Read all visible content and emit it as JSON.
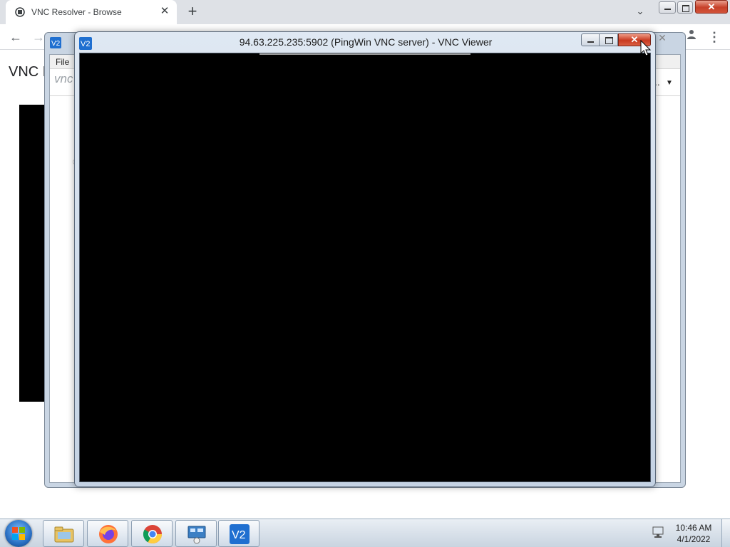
{
  "browser": {
    "tab_title": "VNC Resolver - Browse",
    "tab_close": "✕",
    "new_tab": "+",
    "tab_search": "⌄",
    "back": "←",
    "forward": "→",
    "menu": "⋮",
    "page_heading": "VNC R"
  },
  "bg_window": {
    "menu_file": "File",
    "logo_text": "vnc",
    "dots": "..",
    "dropdown": "▼",
    "side_text": "C..."
  },
  "vnc_window": {
    "title": "94.63.225.235:5902 (PingWin VNC server) - VNC Viewer",
    "close_glyph": "✕"
  },
  "taskbar": {
    "apps": [
      "file-explorer",
      "firefox",
      "chrome",
      "network-app",
      "vnc-viewer"
    ],
    "time": "10:46 AM",
    "date": "4/1/2022"
  },
  "colors": {
    "vnc_blue": "#1f6fd0",
    "close_red": "#c9391f",
    "screen": "#000000"
  }
}
